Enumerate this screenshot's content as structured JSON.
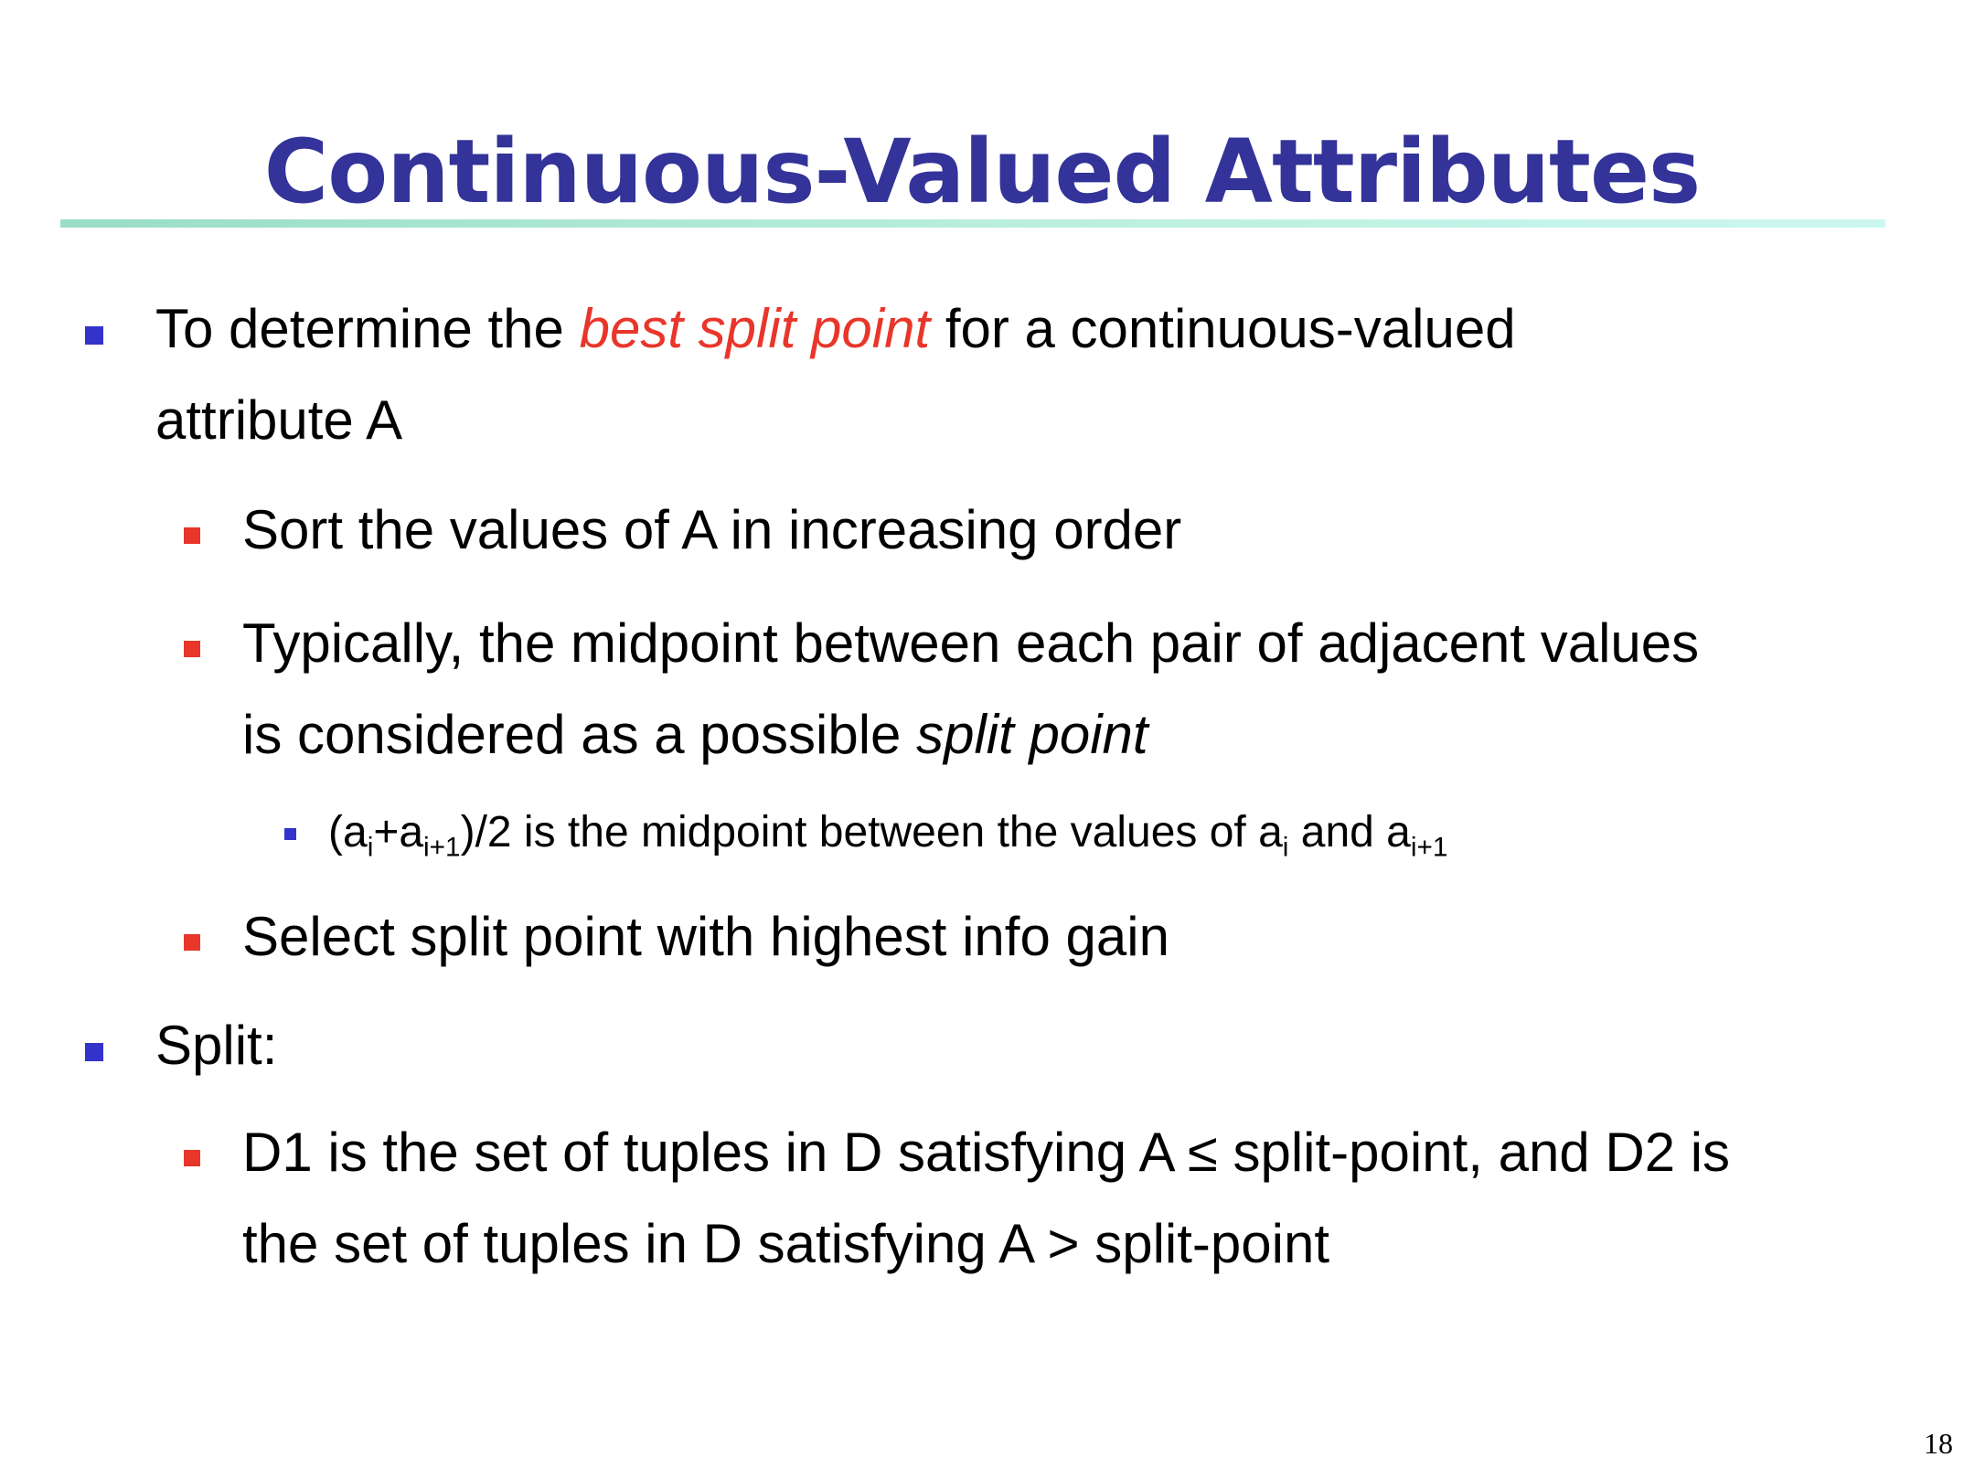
{
  "slide": {
    "title": "Continuous-Valued Attributes",
    "page_number": "18",
    "colors": {
      "title": "#333399",
      "level1_bullet": "#3333cc",
      "level2_bullet": "#e8362a",
      "emphasis_red": "#e8362a"
    },
    "bullets": {
      "b1": {
        "before": "To determine the ",
        "emphasis": "best split point",
        "after_line1": " for a continuous-valued",
        "line2": "attribute A"
      },
      "b1_1": "Sort the values of A in increasing order",
      "b1_2": {
        "line1": "Typically, the midpoint between each pair of adjacent values",
        "line2_before": "is considered as a possible ",
        "line2_emphasis": "split point"
      },
      "b1_2_1": {
        "p1": "(a",
        "s1": "i",
        "p2": "+a",
        "s2": "i+1",
        "p3": ")/2 is the midpoint between the values of a",
        "s3": "i",
        "p4": " and a",
        "s4": "i+1"
      },
      "b1_3": "Select split point with highest info gain",
      "b2": "Split:",
      "b2_1": {
        "line1": "D1 is the set of tuples in D satisfying A ≤ split-point, and D2 is",
        "line2": "the set of tuples in D satisfying A > split-point"
      }
    }
  }
}
